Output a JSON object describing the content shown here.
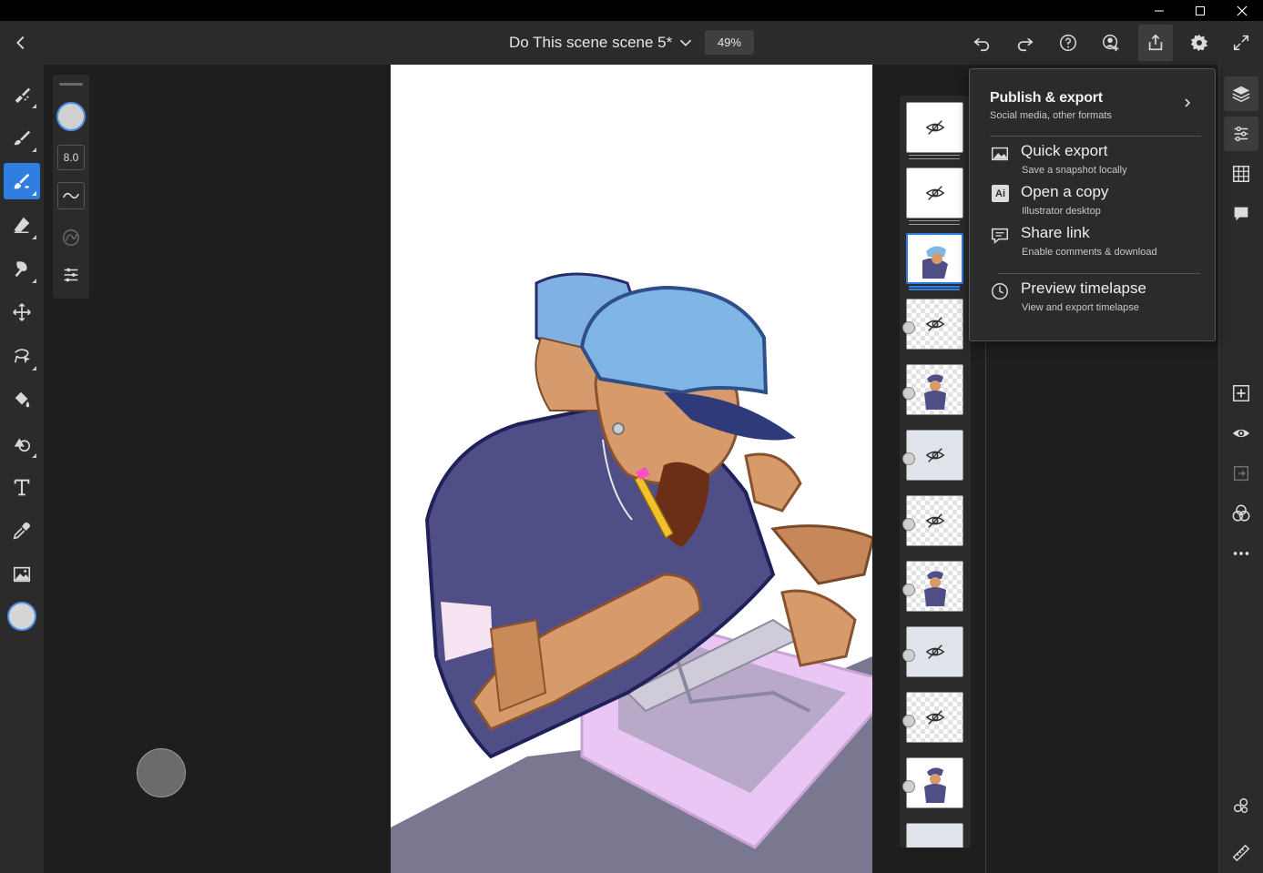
{
  "window": {
    "controls": [
      "minimize-icon",
      "maximize-icon",
      "close-icon"
    ]
  },
  "header": {
    "back_icon": "chevron-left-icon",
    "document_title": "Do This scene scene 5*",
    "zoom": "49%",
    "actions": [
      "undo-icon",
      "redo-icon",
      "help-icon",
      "invite-icon",
      "share-icon",
      "settings-icon",
      "fullscreen-icon"
    ]
  },
  "tools": [
    "pixel-brush-icon",
    "vector-brush-icon",
    "paint-brush-icon",
    "eraser-icon",
    "smudge-icon",
    "move-icon",
    "lasso-icon",
    "fill-icon",
    "shapes-icon",
    "text-icon",
    "eyedropper-icon",
    "image-icon"
  ],
  "brush_props": {
    "size": "8.0"
  },
  "colors": {
    "accent": "#2f7de1",
    "panel": "#2b2b2b",
    "canvas": "#ffffff",
    "current_color": "#d6d6d6"
  },
  "layers": {
    "count_visible": 12,
    "selected_index": 2
  },
  "publish_menu": {
    "title": "Publish & export",
    "subtitle": "Social media, other formats",
    "items": [
      {
        "icon": "image-icon",
        "label": "Quick export",
        "sub": "Save a snapshot locally"
      },
      {
        "icon": "illustrator-icon",
        "label": "Open a copy",
        "sub": "Illustrator desktop"
      },
      {
        "icon": "comment-icon",
        "label": "Share link",
        "sub": "Enable comments & download"
      },
      {
        "icon": "clock-icon",
        "label": "Preview timelapse",
        "sub": "View and export timelapse"
      }
    ],
    "ai_badge": "Ai"
  },
  "right_rail": [
    "layers-icon",
    "layer-properties-icon",
    "grid-icon",
    "comments-icon",
    "add-layer-icon",
    "visibility-icon",
    "merge-icon",
    "blend-icon",
    "more-icon",
    "cloud-link-icon",
    "ruler-icon"
  ]
}
